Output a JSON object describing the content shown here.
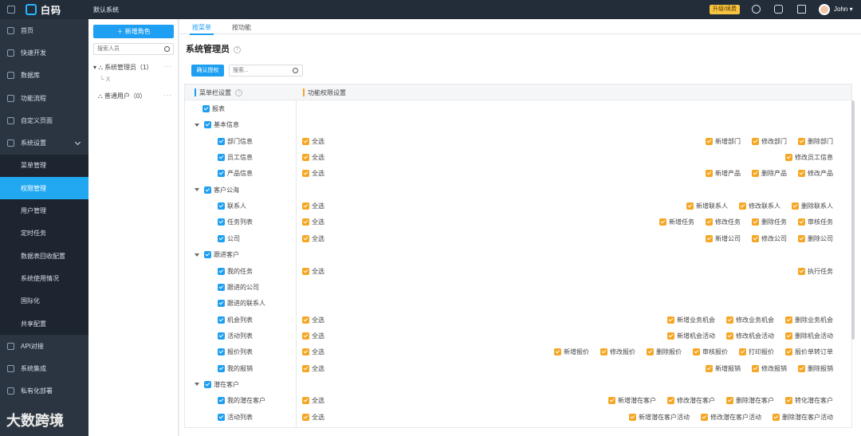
{
  "topbar": {
    "logo_text": "白码",
    "system_name": "默认系统",
    "upgrade_label": "升级/续费",
    "user_name": "John"
  },
  "sidebar": {
    "items": [
      {
        "label": "首页",
        "icon": "home-icon"
      },
      {
        "label": "快速开发",
        "icon": "cube-icon"
      },
      {
        "label": "数据库",
        "icon": "database-icon"
      },
      {
        "label": "功能流程",
        "icon": "flow-icon"
      },
      {
        "label": "自定义页面",
        "icon": "page-icon"
      },
      {
        "label": "系统设置",
        "icon": "monitor-icon"
      }
    ],
    "subitems": [
      "菜单管理",
      "权限管理",
      "用户管理",
      "定时任务",
      "数据表回收配置",
      "系统使用情况",
      "国际化",
      "共享配置"
    ],
    "bottom_items": [
      {
        "label": "API对接",
        "icon": "api-icon"
      },
      {
        "label": "系统集成",
        "icon": "integration-icon"
      },
      {
        "label": "私有化部署",
        "icon": "deploy-icon"
      }
    ]
  },
  "roles": {
    "add_label": "＋  新增角色",
    "search_placeholder": "搜索人员",
    "tree": [
      {
        "label": "系统管理员（1）",
        "child": "X"
      },
      {
        "label": "普通用户（0）"
      }
    ],
    "more": "···"
  },
  "main": {
    "tabs": [
      "按菜单",
      "按功能"
    ],
    "title": "系统管理员",
    "confirm_label": "确认授权",
    "search_placeholder": "搜索...",
    "col_menu": "菜单栏设置",
    "col_perm": "功能权限设置",
    "rows": [
      {
        "label": "报表",
        "level": 0,
        "collapse": false,
        "selectAll": false,
        "perms": []
      },
      {
        "label": "基本信息",
        "level": 0,
        "collapse": true,
        "selectAll": false,
        "perms": []
      },
      {
        "label": "部门信息",
        "level": 1,
        "selectAll": true,
        "perms": [
          "新增部门",
          "修改部门",
          "删除部门"
        ]
      },
      {
        "label": "员工信息",
        "level": 1,
        "selectAll": true,
        "perms": [
          "修改员工信息"
        ]
      },
      {
        "label": "产品信息",
        "level": 1,
        "selectAll": true,
        "perms": [
          "新增产品",
          "删除产品",
          "修改产品"
        ]
      },
      {
        "label": "客户公海",
        "level": 0,
        "collapse": true,
        "selectAll": false,
        "perms": []
      },
      {
        "label": "联系人",
        "level": 1,
        "selectAll": true,
        "perms": [
          "新增联系人",
          "修改联系人",
          "删除联系人"
        ]
      },
      {
        "label": "任务列表",
        "level": 1,
        "selectAll": true,
        "perms": [
          "新增任务",
          "修改任务",
          "删除任务",
          "审核任务"
        ]
      },
      {
        "label": "公司",
        "level": 1,
        "selectAll": true,
        "perms": [
          "新增公司",
          "修改公司",
          "删除公司"
        ]
      },
      {
        "label": "跟进客户",
        "level": 0,
        "collapse": true,
        "selectAll": false,
        "perms": []
      },
      {
        "label": "我的任务",
        "level": 1,
        "selectAll": true,
        "perms": [
          "执行任务"
        ]
      },
      {
        "label": "跟进的公司",
        "level": 1,
        "selectAll": false,
        "perms": []
      },
      {
        "label": "跟进的联系人",
        "level": 1,
        "selectAll": false,
        "perms": []
      },
      {
        "label": "机会列表",
        "level": 1,
        "selectAll": true,
        "perms": [
          "新增业务机会",
          "修改业务机会",
          "删除业务机会"
        ]
      },
      {
        "label": "活动列表",
        "level": 1,
        "selectAll": true,
        "perms": [
          "新增机会活动",
          "修改机会活动",
          "删除机会活动"
        ]
      },
      {
        "label": "报价列表",
        "level": 1,
        "selectAll": true,
        "perms": [
          "新增报价",
          "修改报价",
          "删除报价",
          "审核报价",
          "打印报价",
          "报价单转订单"
        ]
      },
      {
        "label": "我的报销",
        "level": 1,
        "selectAll": true,
        "perms": [
          "新增报销",
          "修改报销",
          "删除报销"
        ]
      },
      {
        "label": "潜在客户",
        "level": 0,
        "collapse": true,
        "selectAll": false,
        "perms": []
      },
      {
        "label": "我的潜在客户",
        "level": 1,
        "selectAll": true,
        "perms": [
          "新增潜在客户",
          "修改潜在客户",
          "删除潜在客户",
          "转化潜在客户"
        ]
      },
      {
        "label": "活动列表",
        "level": 1,
        "selectAll": true,
        "perms": [
          "新增潜在客户活动",
          "修改潜在客户活动",
          "删除潜在客户活动"
        ]
      }
    ],
    "select_all_label": "全选"
  },
  "watermark": "大数跨境",
  "colors": {
    "accent": "#1e9ff2",
    "orange": "#f5a623",
    "sidebar": "#2b3441",
    "topbar": "#232d3a"
  }
}
